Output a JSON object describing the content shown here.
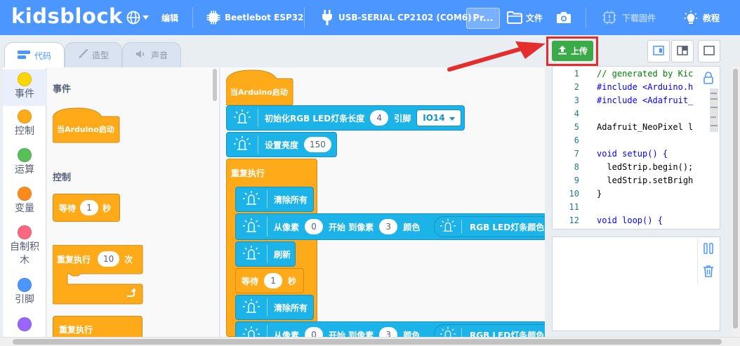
{
  "header": {
    "logo": "kidsblock",
    "edit_label": "编辑",
    "board": "Beetlebot ESP32",
    "port": "USB-SERIAL CP2102 (COM6)",
    "project_short": "Pr...",
    "file_label": "文件",
    "download_fw_label": "下载固件",
    "tutorial_label": "教程"
  },
  "tabs": [
    {
      "label": "代码",
      "icon": "code-icon"
    },
    {
      "label": "造型",
      "icon": "brush-icon"
    },
    {
      "label": "声音",
      "icon": "speaker-icon"
    }
  ],
  "categories": [
    {
      "label": "事件",
      "color": "#ffd500"
    },
    {
      "label": "控制",
      "color": "#ffab19"
    },
    {
      "label": "运算",
      "color": "#59c059"
    },
    {
      "label": "变量",
      "color": "#ff8c1a"
    },
    {
      "label": "自制积木",
      "color": "#ff6680"
    },
    {
      "label": "引脚",
      "color": "#4c97ff"
    },
    {
      "label": "",
      "color": "#9966ff"
    }
  ],
  "palette": {
    "events_head": "事件",
    "hat_label": "当Arduino启动",
    "control_head": "控制",
    "wait_label": "等待",
    "wait_value": "1",
    "wait_unit": "秒",
    "repeat_label": "重复执行",
    "repeat_value": "10",
    "repeat_unit": "次",
    "forever_label": "重复执行"
  },
  "workspace": {
    "hat": "当Arduino启动",
    "init_strip": "初始化RGB LED灯条长度",
    "init_len": "4",
    "init_pin_label": "引脚",
    "init_pin": "IO14",
    "brightness_label": "设置亮度",
    "brightness_value": "150",
    "forever": "重复执行",
    "clear_all": "清除所有",
    "from_pixel": "从像素",
    "from_value": "0",
    "to_pixel_label": "开始 到像素",
    "to_value": "3",
    "color_label": "颜色",
    "inner_color": "RGB LED灯条颜色",
    "refresh": "刷新",
    "wait": "等待",
    "wait_value": "1",
    "wait_unit": "秒",
    "clear_all_2": "清除所有",
    "from_pixel_2": "从像素",
    "from_value_2": "0",
    "to_pixel_label_2": "开始 到像素",
    "to_value_2": "3",
    "color_label_2": "颜色",
    "inner_color_2": "RGB LED灯条颜色"
  },
  "upload": {
    "label": "上传"
  },
  "code": {
    "line_numbers": [
      "1",
      "2",
      "3",
      "4",
      "5",
      "6",
      "7",
      "8",
      "9",
      "10",
      "11",
      "12"
    ],
    "lines": [
      "// generated by Kic",
      "#include <Arduino.h",
      "#include <Adafruit_",
      "",
      "Adafruit_NeoPixel l",
      "",
      "void setup() {",
      "  ledStrip.begin();",
      "  ledStrip.setBrigh",
      "}",
      "",
      "void loop() {"
    ]
  },
  "colors": {
    "topbar": "#4c97ff",
    "upload": "#3aab48",
    "highlight": "#e52d2d",
    "cyan_block": "#1cb4e8",
    "orange_block": "#ffab19"
  }
}
